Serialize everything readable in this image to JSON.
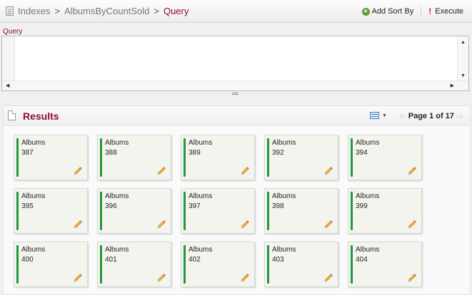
{
  "breadcrumb": {
    "items": [
      "Indexes",
      "AlbumsByCountSold"
    ],
    "current": "Query",
    "separator": ">"
  },
  "toolbar": {
    "add_sort_label": "Add Sort By",
    "execute_label": "Execute"
  },
  "query": {
    "label": "Query",
    "text": ""
  },
  "results": {
    "title": "Results",
    "page_info": "Page 1 of 17",
    "cards": [
      {
        "collection": "Albums",
        "id": "387"
      },
      {
        "collection": "Albums",
        "id": "388"
      },
      {
        "collection": "Albums",
        "id": "389"
      },
      {
        "collection": "Albums",
        "id": "392"
      },
      {
        "collection": "Albums",
        "id": "394"
      },
      {
        "collection": "Albums",
        "id": "395"
      },
      {
        "collection": "Albums",
        "id": "396"
      },
      {
        "collection": "Albums",
        "id": "397"
      },
      {
        "collection": "Albums",
        "id": "398"
      },
      {
        "collection": "Albums",
        "id": "399"
      },
      {
        "collection": "Albums",
        "id": "400"
      },
      {
        "collection": "Albums",
        "id": "401"
      },
      {
        "collection": "Albums",
        "id": "402"
      },
      {
        "collection": "Albums",
        "id": "403"
      },
      {
        "collection": "Albums",
        "id": "404"
      }
    ]
  },
  "colors": {
    "accent": "#8b0a3a",
    "card_bar": "#1f9a3f",
    "card_bg": "#f4f4ee"
  },
  "icons": {
    "breadcrumb": "database-icon",
    "add_sort": "plus-icon",
    "execute": "exclamation-icon",
    "results": "document-icon",
    "view": "grid-view-icon",
    "edit": "pencil-icon"
  }
}
